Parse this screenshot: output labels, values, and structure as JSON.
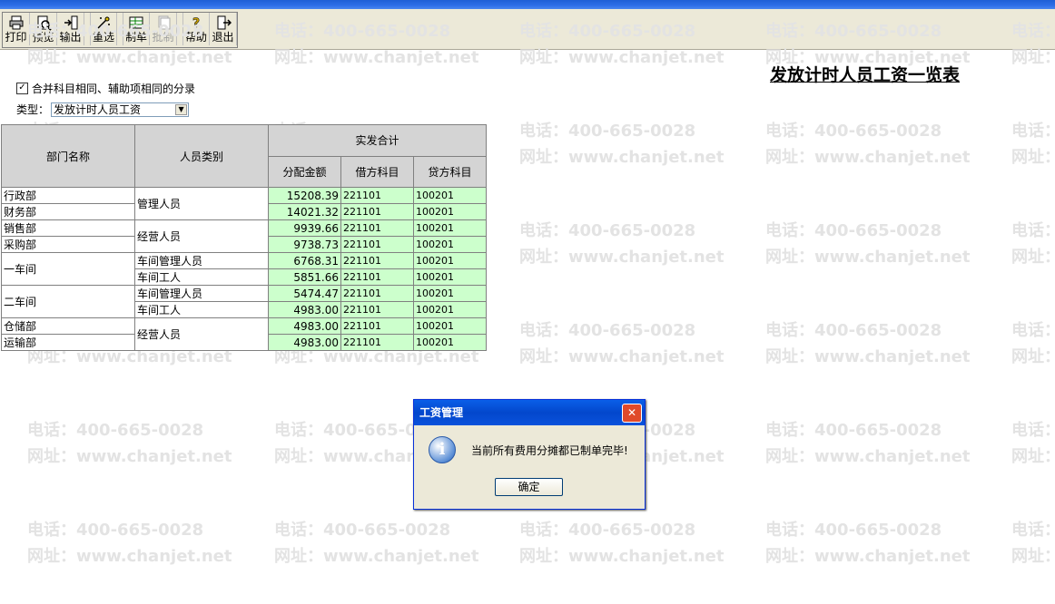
{
  "toolbar": {
    "buttons": [
      {
        "label": "打印",
        "icon": "printer-icon"
      },
      {
        "label": "预览",
        "icon": "preview-icon"
      },
      {
        "label": "输出",
        "icon": "export-icon"
      },
      {
        "label": "重选",
        "icon": "reselect-icon"
      },
      {
        "label": "制单",
        "icon": "voucher-icon"
      },
      {
        "label": "批制",
        "icon": "batch-voucher-icon",
        "disabled": true
      },
      {
        "label": "帮助",
        "icon": "help-icon"
      },
      {
        "label": "退出",
        "icon": "exit-icon"
      }
    ]
  },
  "watermark": {
    "phone": "电话：400-665-0028",
    "website": "网址：www.chanjet.net",
    "phone_partial": "电话：",
    "website_partial": "网址："
  },
  "report": {
    "title": "发放计时人员工资一览表",
    "merge_checkbox_label": "合并科目相同、辅助项相同的分录",
    "merge_checked": true,
    "type_label": "类型：",
    "type_value": "发放计时人员工资"
  },
  "table": {
    "headers": {
      "dept": "部门名称",
      "category": "人员类别",
      "group": "实发合计",
      "amount": "分配金额",
      "debit": "借方科目",
      "credit": "贷方科目"
    },
    "rows": [
      {
        "dept": "行政部",
        "amount": "15208.39",
        "debit": "221101",
        "credit": "100201"
      },
      {
        "dept": "财务部",
        "amount": "14021.32",
        "debit": "221101",
        "credit": "100201"
      },
      {
        "dept": "销售部",
        "amount": "9939.66",
        "debit": "221101",
        "credit": "100201"
      },
      {
        "dept": "采购部",
        "amount": "9738.73",
        "debit": "221101",
        "credit": "100201"
      },
      {
        "dept": "一车间",
        "amount": "6768.31",
        "debit": "221101",
        "credit": "100201"
      },
      {
        "dept": "",
        "amount": "5851.66",
        "debit": "221101",
        "credit": "100201"
      },
      {
        "dept": "二车间",
        "amount": "5474.47",
        "debit": "221101",
        "credit": "100201"
      },
      {
        "dept": "",
        "amount": "4983.00",
        "debit": "221101",
        "credit": "100201"
      },
      {
        "dept": "仓储部",
        "amount": "4983.00",
        "debit": "221101",
        "credit": "100201"
      },
      {
        "dept": "运输部",
        "amount": "4983.00",
        "debit": "221101",
        "credit": "100201"
      }
    ],
    "categories": [
      "管理人员",
      "经营人员",
      "车间管理人员",
      "车间工人",
      "车间管理人员",
      "车间工人",
      "经营人员"
    ]
  },
  "dialog": {
    "title": "工资管理",
    "message": "当前所有费用分摊都已制单完毕!",
    "ok_label": "确定",
    "close_symbol": "✕",
    "icon_symbol": "i"
  }
}
